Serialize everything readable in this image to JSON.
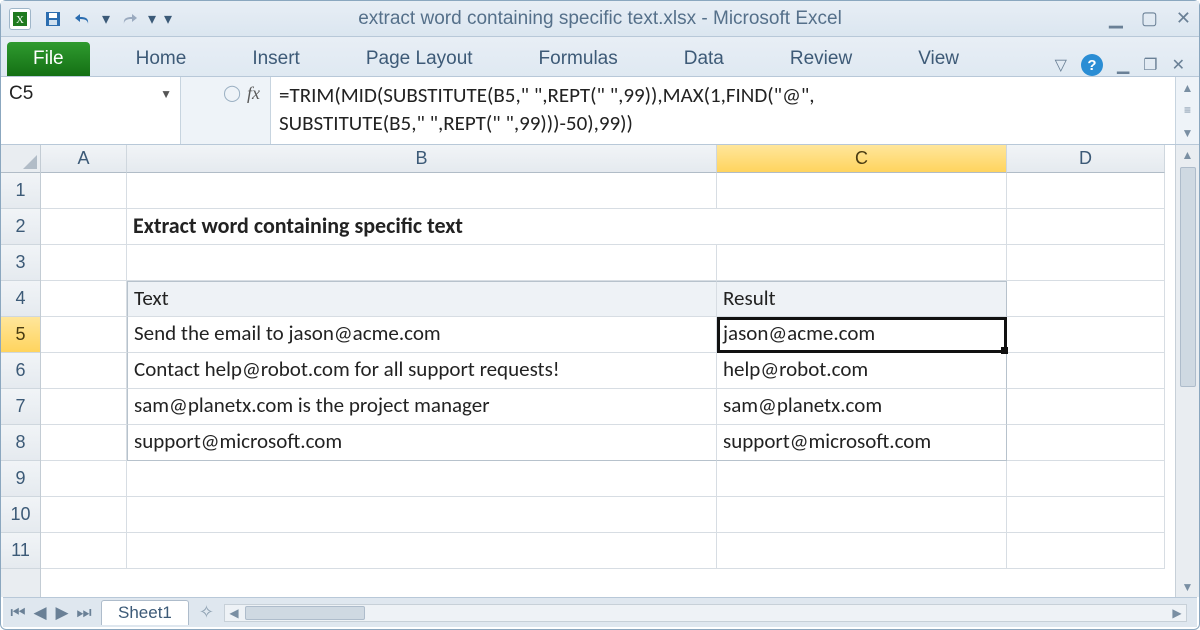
{
  "title": "extract word containing specific text.xlsx  -  Microsoft Excel",
  "ribbon": {
    "file": "File",
    "tabs": [
      "Home",
      "Insert",
      "Page Layout",
      "Formulas",
      "Data",
      "Review",
      "View"
    ]
  },
  "namebox": "C5",
  "formula_line1": "=TRIM(MID(SUBSTITUTE(B5,\" \",REPT(\" \",99)),MAX(1,FIND(\"@\",",
  "formula_line2": "SUBSTITUTE(B5,\" \",REPT(\" \",99)))-50),99))",
  "columns": [
    "A",
    "B",
    "C",
    "D"
  ],
  "row_numbers": [
    "1",
    "2",
    "3",
    "4",
    "5",
    "6",
    "7",
    "8",
    "9",
    "10",
    "11"
  ],
  "heading": "Extract word containing specific text",
  "table": {
    "header_text": "Text",
    "header_result": "Result",
    "rows": [
      {
        "text": "Send the email to jason@acme.com",
        "result": "jason@acme.com"
      },
      {
        "text": "Contact help@robot.com for all support requests!",
        "result": "help@robot.com"
      },
      {
        "text": "sam@planetx.com is the project manager",
        "result": "sam@planetx.com"
      },
      {
        "text": "support@microsoft.com",
        "result": "support@microsoft.com"
      }
    ]
  },
  "sheet_tab": "Sheet1"
}
